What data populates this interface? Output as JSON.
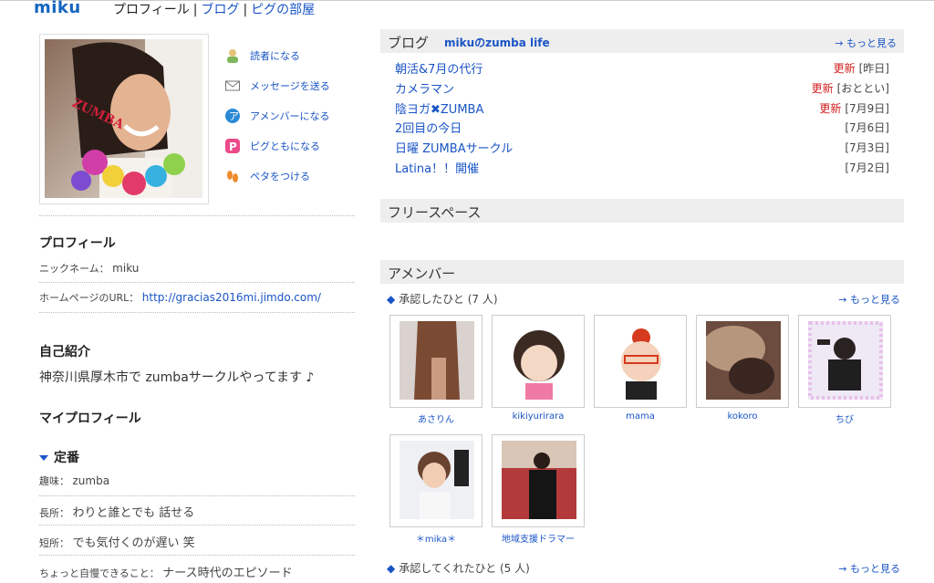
{
  "header": {
    "user_name": "miku",
    "nav": [
      "プロフィール",
      "ブログ",
      "ピグの部屋"
    ]
  },
  "actions": [
    {
      "label": "読者になる",
      "icon": "reader-icon"
    },
    {
      "label": "メッセージを送る",
      "icon": "mail-icon"
    },
    {
      "label": "アメンバーになる",
      "icon": "amember-icon"
    },
    {
      "label": "ピグともになる",
      "icon": "pigg-icon"
    },
    {
      "label": "ペタをつける",
      "icon": "footprint-icon"
    }
  ],
  "photo_caption": "ZUMBA",
  "profile": {
    "title": "プロフィール",
    "nickname_label": "ニックネーム：",
    "nickname": "miku",
    "homepage_label": "ホームページのURL：",
    "homepage": "http://gracias2016mi.jimdo.com/"
  },
  "intro": {
    "title": "自己紹介",
    "text": "神奈川県厚木市で zumbaサークルやってます ♪"
  },
  "my_profile": {
    "title": "マイプロフィール",
    "section": "定番",
    "items": [
      {
        "label": "趣味：",
        "value": "zumba"
      },
      {
        "label": "長所：",
        "value": "わりと誰とでも 話せる"
      },
      {
        "label": "短所：",
        "value": "でも気付くのが遅い 笑"
      },
      {
        "label": "ちょっと自慢できること：",
        "value": "ナース時代のエピソード"
      }
    ]
  },
  "blog": {
    "title": "ブログ",
    "name": "mikuのzumba life",
    "more": "→ もっと見る",
    "entries": [
      {
        "title": "朝活&7月の代行",
        "updated": "更新",
        "date": "[昨日]"
      },
      {
        "title": "カメラマン",
        "updated": "更新",
        "date": "[おととい]"
      },
      {
        "title": "陰ヨガ✖ZUMBA",
        "updated": "更新",
        "date": "[7月9日]"
      },
      {
        "title": "2回目の今日",
        "updated": "",
        "date": "[7月6日]"
      },
      {
        "title": "日曜 ZUMBAサークル",
        "updated": "",
        "date": "[7月3日]"
      },
      {
        "title": "Latina！！開催",
        "updated": "",
        "date": "[7月2日]"
      }
    ]
  },
  "free_space": {
    "title": "フリースペース"
  },
  "amember": {
    "title": "アメンバー",
    "approved_label": "承認したひと",
    "approved_count": "(7 人)",
    "approved_by_label": "承認してくれたひと",
    "approved_by_count": "(5 人)",
    "more": "→ もっと見る",
    "members": [
      {
        "name": "あさりん"
      },
      {
        "name": "kikiyurirara"
      },
      {
        "name": "mama"
      },
      {
        "name": "kokoro"
      },
      {
        "name": "ちび"
      },
      {
        "name": "＊mika＊"
      },
      {
        "name": "地域支援ドラマー"
      }
    ]
  },
  "colors": {
    "link": "#1a55c6",
    "update": "#d21e1e",
    "panel": "#eeeeee"
  }
}
